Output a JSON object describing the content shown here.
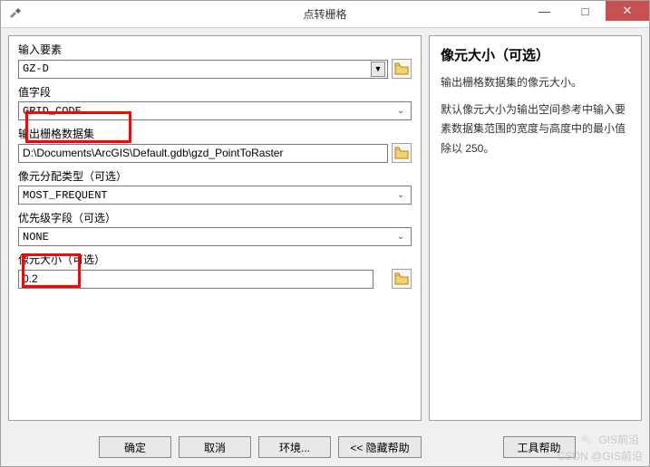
{
  "window": {
    "title": "点转栅格"
  },
  "titlebar": {
    "min": "—",
    "max": "□",
    "close": "✕"
  },
  "form": {
    "input_features": {
      "label": "输入要素",
      "value": "GZ-D"
    },
    "value_field": {
      "label": "值字段",
      "value": "GRID_CODE"
    },
    "output_raster": {
      "label": "输出栅格数据集",
      "value": "D:\\Documents\\ArcGIS\\Default.gdb\\gzd_PointToRaster"
    },
    "cell_assignment": {
      "label": "像元分配类型（可选）",
      "value": "MOST_FREQUENT"
    },
    "priority_field": {
      "label": "优先级字段（可选）",
      "value": "NONE"
    },
    "cell_size": {
      "label": "像元大小（可选）",
      "value": "0.2"
    }
  },
  "help": {
    "title": "像元大小（可选）",
    "p1": "输出栅格数据集的像元大小。",
    "p2": "默认像元大小为输出空间参考中输入要素数据集范围的宽度与高度中的最小值除以 250。"
  },
  "buttons": {
    "ok": "确定",
    "cancel": "取消",
    "env": "环境...",
    "hide_help": "<< 隐藏帮助",
    "tool_help": "工具帮助"
  },
  "watermark": {
    "line1": "GIS前沿",
    "line2": "CSDN @GIS前沿"
  }
}
